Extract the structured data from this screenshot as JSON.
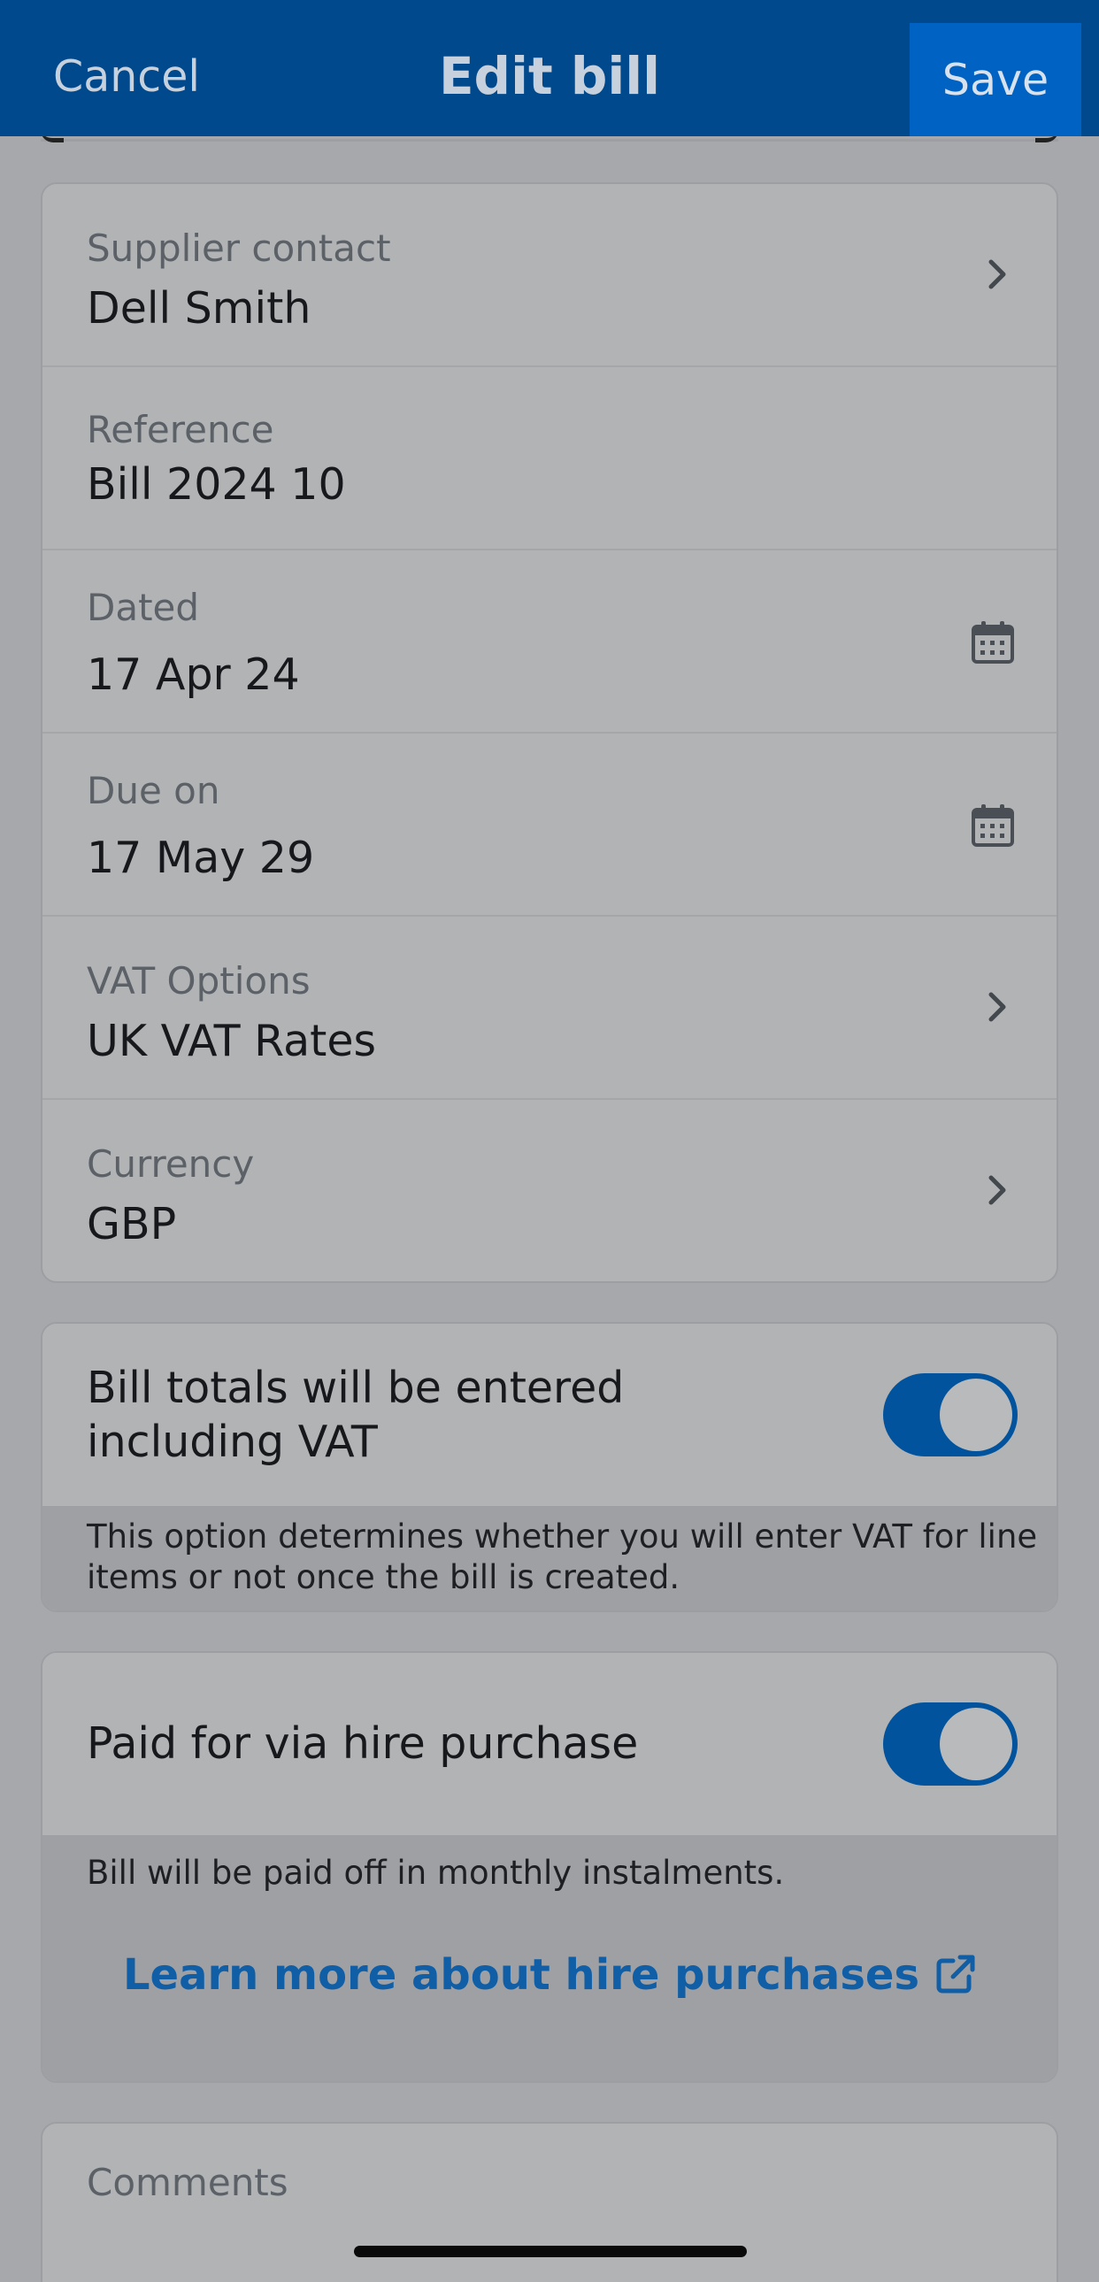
{
  "header": {
    "cancel_label": "Cancel",
    "title": "Edit bill",
    "save_label": "Save"
  },
  "details": {
    "supplier": {
      "label": "Supplier contact",
      "value": "Dell Smith"
    },
    "reference": {
      "label": "Reference",
      "value": "Bill 2024 10"
    },
    "dated": {
      "label": "Dated",
      "value": "17 Apr 24"
    },
    "due_on": {
      "label": "Due on",
      "value": "17 May 29"
    },
    "vat_options": {
      "label": "VAT Options",
      "value": "UK VAT Rates"
    },
    "currency": {
      "label": "Currency",
      "value": "GBP"
    }
  },
  "vat_inclusive": {
    "line1": "Bill totals will be entered",
    "line2": "including VAT",
    "enabled": true,
    "note_line1": "This option determines whether you will enter VAT for line",
    "note_line2": "items or not once the bill is created."
  },
  "hire_purchase": {
    "label": "Paid for via hire purchase",
    "enabled": true,
    "note": "Bill will be paid off in monthly instalments.",
    "learn_more": "Learn more about hire purchases"
  },
  "comments": {
    "label": "Comments"
  },
  "colors": {
    "header_bg": "#00498c",
    "save_bg": "#0063c4",
    "toggle_on": "#00539c",
    "link": "#0f5ea6"
  },
  "icons": {
    "chevron": "chevron-right-icon",
    "calendar": "calendar-icon",
    "external": "external-link-icon"
  }
}
